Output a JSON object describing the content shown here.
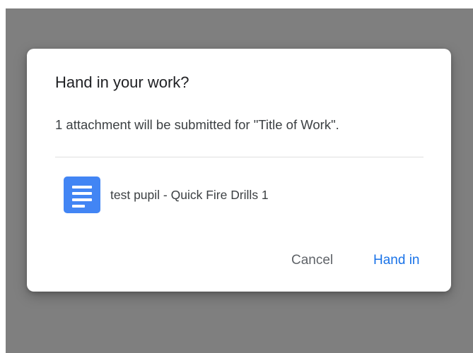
{
  "dialog": {
    "title": "Hand in your work?",
    "message": "1 attachment will be submitted for \"Title of Work\".",
    "attachment": {
      "name": "test pupil - Quick Fire Drills 1",
      "icon": "google-docs-icon",
      "icon_color": "#4285f4"
    },
    "buttons": {
      "cancel_label": "Cancel",
      "hand_in_label": "Hand in"
    }
  },
  "colors": {
    "overlay": "#7f7f7f",
    "primary_action": "#1a73e8",
    "secondary_action": "#5f6368"
  }
}
